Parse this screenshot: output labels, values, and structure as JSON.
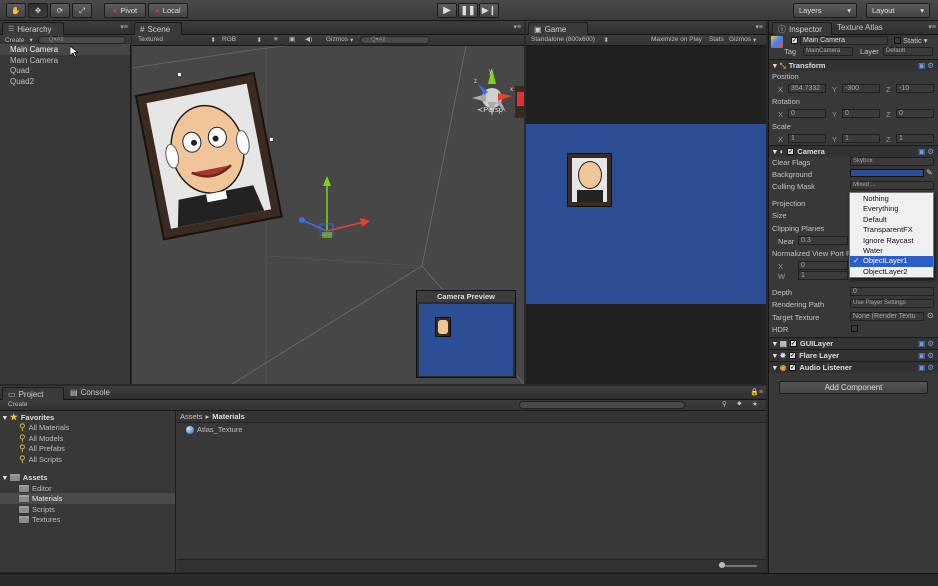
{
  "toolbar": {
    "pivot": "Pivot",
    "local": "Local",
    "layers": "Layers",
    "layout": "Layout"
  },
  "hierarchy": {
    "tab": "Hierarchy",
    "create": "Create",
    "search_placeholder": "Q▾All",
    "items": [
      "Main Camera",
      "Main Camera",
      "Quad",
      "Quad2"
    ]
  },
  "scene": {
    "tab": "Scene",
    "shading": "Textured",
    "render": "RGB",
    "gizmos": "Gizmos",
    "search_placeholder": "Q▾All",
    "persp": "Persp",
    "preview_title": "Camera Preview"
  },
  "game": {
    "tab": "Game",
    "aspect": "Standalone (800x600)",
    "maximize": "Maximize on Play",
    "stats": "Stats",
    "gizmos": "Gizmos"
  },
  "inspector": {
    "tab": "Inspector",
    "tab2": "Texture Atlas",
    "object_name": "Main Camera",
    "static": "Static",
    "tag_label": "Tag",
    "tag_value": "MainCamera",
    "layer_label": "Layer",
    "layer_value": "Default",
    "transform": "Transform",
    "position": "Position",
    "pos": {
      "x": "354.7332",
      "y": "-300",
      "z": "-10"
    },
    "rotation": "Rotation",
    "rot": {
      "x": "0",
      "y": "0",
      "z": "0"
    },
    "scale": "Scale",
    "scl": {
      "x": "1",
      "y": "1",
      "z": "1"
    },
    "axis_x": "X",
    "axis_y": "Y",
    "axis_z": "Z",
    "axis_w": "W",
    "camera": "Camera",
    "clear_flags": "Clear Flags",
    "clear_flags_value": "Skybox",
    "background": "Background",
    "culling_mask": "Culling Mask",
    "culling_mask_value": "Mixed ...",
    "projection": "Projection",
    "size": "Size",
    "clipping_planes": "Clipping Planes",
    "near": "Near",
    "near_value": "0.3",
    "viewport": "Normalized View Port R",
    "vp_x": "0",
    "vp_w": "1",
    "depth": "Depth",
    "depth_value": "0",
    "rendering_path": "Rendering Path",
    "rendering_path_value": "Use Player Settings",
    "target_texture": "Target Texture",
    "target_texture_value": "None (Render Textu",
    "hdr": "HDR",
    "guilayer": "GUILayer",
    "flare_layer": "Flare Layer",
    "audio_listener": "Audio Listener",
    "add_component": "Add Component",
    "background_color": "#2b4f96"
  },
  "culling_dropdown": {
    "options": [
      "Nothing",
      "Everything",
      "Default",
      "TransparentFX",
      "Ignore Raycast",
      "Water",
      "ObjectLayer1",
      "ObjectLayer2"
    ],
    "selected": "ObjectLayer1"
  },
  "project": {
    "tab": "Project",
    "tab2": "Console",
    "create": "Create",
    "favorites": "Favorites",
    "favorite_items": [
      "All Materials",
      "All Models",
      "All Prefabs",
      "All Scripts"
    ],
    "assets": "Assets",
    "asset_folders": [
      "Editor",
      "Materials",
      "Scripts",
      "Textures"
    ],
    "breadcrumb_root": "Assets",
    "breadcrumb_current": "Materials",
    "files": [
      "Atlas_Texture"
    ]
  },
  "colors": {
    "game_bg": "#2c4e94",
    "selection": "#2c5fcc"
  }
}
